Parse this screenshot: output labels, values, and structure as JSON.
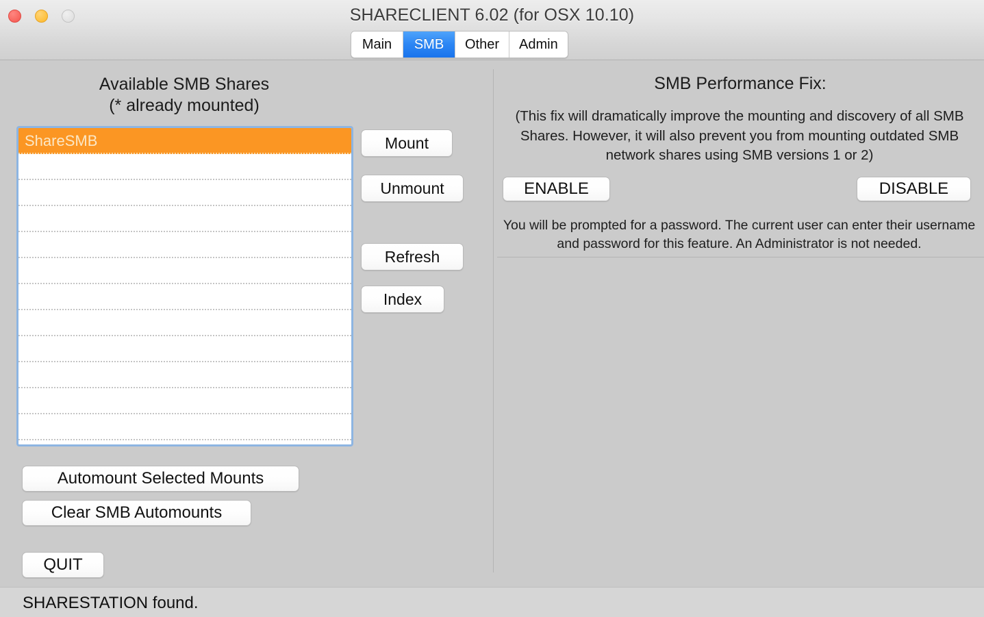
{
  "window": {
    "title": "SHARECLIENT 6.02 (for OSX 10.10)",
    "controls": {
      "close": "close-button",
      "minimize": "minimize-button",
      "zoom": "zoom-button"
    },
    "background_color": "#cbcbcb"
  },
  "tabs": [
    {
      "label": "Main",
      "active": false
    },
    {
      "label": "SMB",
      "active": true
    },
    {
      "label": "Other",
      "active": false
    },
    {
      "label": "Admin",
      "active": false
    }
  ],
  "tab_accent_color": "#2c86f4",
  "left_panel": {
    "heading_line1": "Available SMB Shares",
    "heading_line2": "(* already mounted)",
    "list": {
      "selection_color": "#fb9623",
      "selected_text_color": "#fbe7c5",
      "focus_border_color": "#8db5e2",
      "rows": [
        {
          "label": "ShareSMB",
          "selected": true
        },
        {
          "label": "",
          "selected": false
        },
        {
          "label": "",
          "selected": false
        },
        {
          "label": "",
          "selected": false
        },
        {
          "label": "",
          "selected": false
        },
        {
          "label": "",
          "selected": false
        },
        {
          "label": "",
          "selected": false
        },
        {
          "label": "",
          "selected": false
        },
        {
          "label": "",
          "selected": false
        },
        {
          "label": "",
          "selected": false
        },
        {
          "label": "",
          "selected": false
        },
        {
          "label": "",
          "selected": false
        }
      ]
    },
    "buttons": {
      "mount": "Mount",
      "unmount": "Unmount",
      "refresh": "Refresh",
      "index": "Index",
      "automount": "Automount Selected Mounts",
      "clear": "Clear SMB Automounts",
      "quit": "QUIT"
    }
  },
  "right_panel": {
    "heading": "SMB Performance Fix:",
    "description": "(This fix will dramatically improve the mounting and discovery of all SMB Shares. However, it will also prevent you from mounting outdated SMB network shares using SMB versions 1 or 2)",
    "enable_label": "ENABLE",
    "disable_label": "DISABLE",
    "note": "You will be prompted for a password. The current user can enter their username and password for this feature. An Administrator is not needed."
  },
  "status_bar": {
    "message": "SHARESTATION found."
  }
}
